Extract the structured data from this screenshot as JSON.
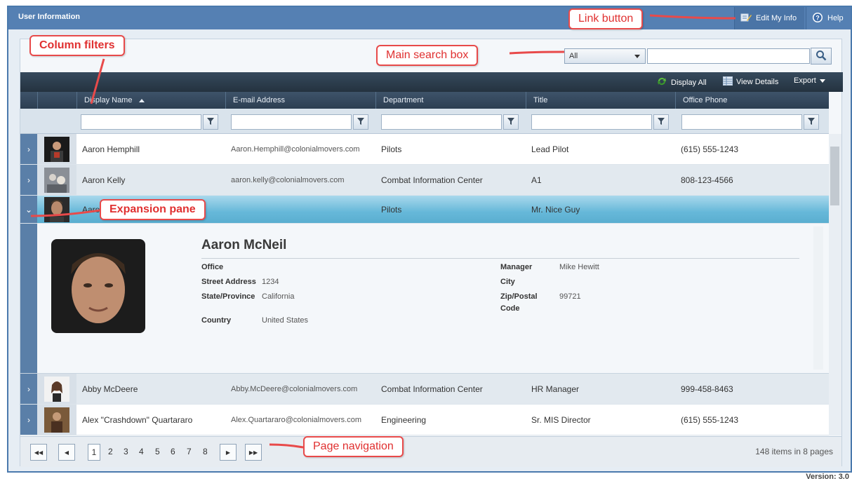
{
  "window": {
    "title": "User Information"
  },
  "titlebar": {
    "edit_label": "Edit My Info",
    "help_label": "Help"
  },
  "search": {
    "scope_selected": "All",
    "query": ""
  },
  "toolbar": {
    "display_all": "Display All",
    "view_details": "View Details",
    "export": "Export"
  },
  "columns": [
    "Display Name",
    "E-mail Address",
    "Department",
    "Title",
    "Office Phone"
  ],
  "sort": {
    "column": "Display Name",
    "direction": "ascending"
  },
  "rows": [
    {
      "name": "Aaron Hemphill",
      "email": "Aaron.Hemphill@colonialmovers.com",
      "department": "Pilots",
      "title": "Lead Pilot",
      "phone": "(615) 555-1243"
    },
    {
      "name": "Aaron Kelly",
      "email": "aaron.kelly@colonialmovers.com",
      "department": "Combat Information Center",
      "title": "A1",
      "phone": "808-123-4566"
    },
    {
      "name": "Aaron McNeil",
      "email": "",
      "department": "Pilots",
      "title": "Mr. Nice Guy",
      "phone": ""
    },
    {
      "name": "Abby McDeere",
      "email": "Abby.McDeere@colonialmovers.com",
      "department": "Combat Information Center",
      "title": "HR Manager",
      "phone": "999-458-8463"
    },
    {
      "name": "Alex \"Crashdown\" Quartararo",
      "email": "Alex.Quartararo@colonialmovers.com",
      "department": "Engineering",
      "title": "Sr. MIS Director",
      "phone": "(615) 555-1243"
    }
  ],
  "detail": {
    "name": "Aaron McNeil",
    "office_label": "Office",
    "office": "",
    "street_label": "Street Address",
    "street": "1234",
    "state_label": "State/Province",
    "state": "California",
    "country_label": "Country",
    "country": "United States",
    "manager_label": "Manager",
    "manager": "Mike Hewitt",
    "city_label": "City",
    "city": "",
    "zip_label_1": "Zip/Postal",
    "zip_label_2": "Code",
    "zip": "99721"
  },
  "pager": {
    "pages": [
      "1",
      "2",
      "3",
      "4",
      "5",
      "6",
      "7",
      "8"
    ],
    "current": "1",
    "summary": "148 items in 8 pages"
  },
  "callouts": {
    "link_button": "Link button",
    "column_filters": "Column filters",
    "main_search": "Main search box",
    "expansion_pane": "Expansion pane",
    "page_navigation": "Page navigation"
  },
  "version": "Version: 3.0",
  "colors": {
    "titlebar": "#5580b3",
    "callout": "#e84a4a",
    "selected_row": "#66b8d9"
  }
}
